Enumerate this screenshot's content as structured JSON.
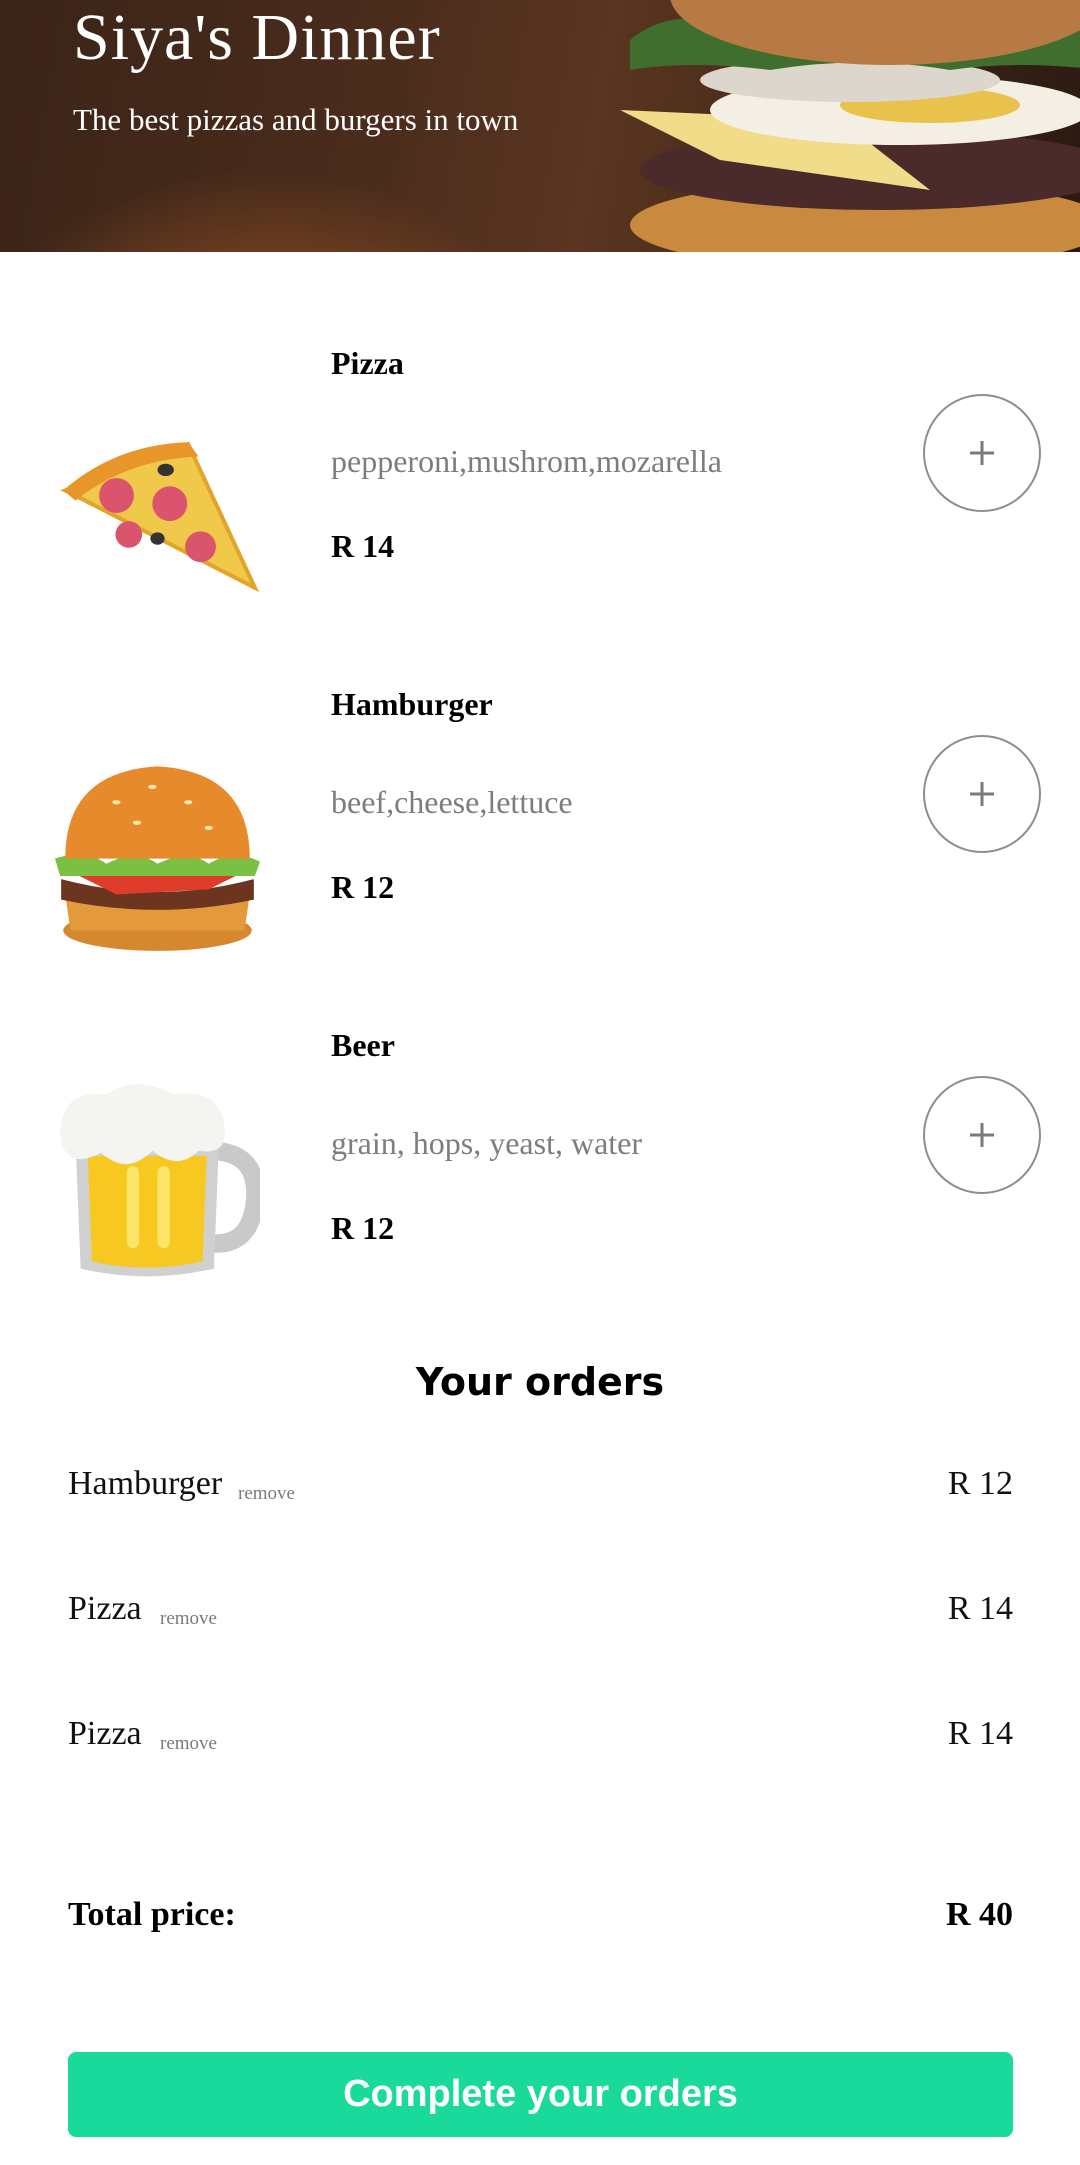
{
  "header": {
    "title": "Siya's Dinner",
    "subtitle": "The best pizzas and burgers in town"
  },
  "menu": {
    "items": [
      {
        "name": "Pizza",
        "description": "pepperoni,mushrom,mozarella",
        "price": "R 14",
        "icon": "pizza-icon"
      },
      {
        "name": "Hamburger",
        "description": "beef,cheese,lettuce",
        "price": "R 12",
        "icon": "hamburger-icon"
      },
      {
        "name": "Beer",
        "description": "grain, hops, yeast, water",
        "price": "R 12",
        "icon": "beer-icon"
      }
    ],
    "add_icon": "plus-icon"
  },
  "orders": {
    "title": "Your orders",
    "items": [
      {
        "name": "Hamburger",
        "remove_label": "remove",
        "price": "R 12"
      },
      {
        "name": "Pizza",
        "remove_label": "remove",
        "price": "R 14"
      },
      {
        "name": "Pizza",
        "remove_label": "remove",
        "price": "R 14"
      }
    ],
    "total_label": "Total price:",
    "total_value": "R 40"
  },
  "actions": {
    "complete_label": "Complete your orders"
  },
  "colors": {
    "accent": "#19d99b",
    "muted_text": "#7d7d7d"
  }
}
